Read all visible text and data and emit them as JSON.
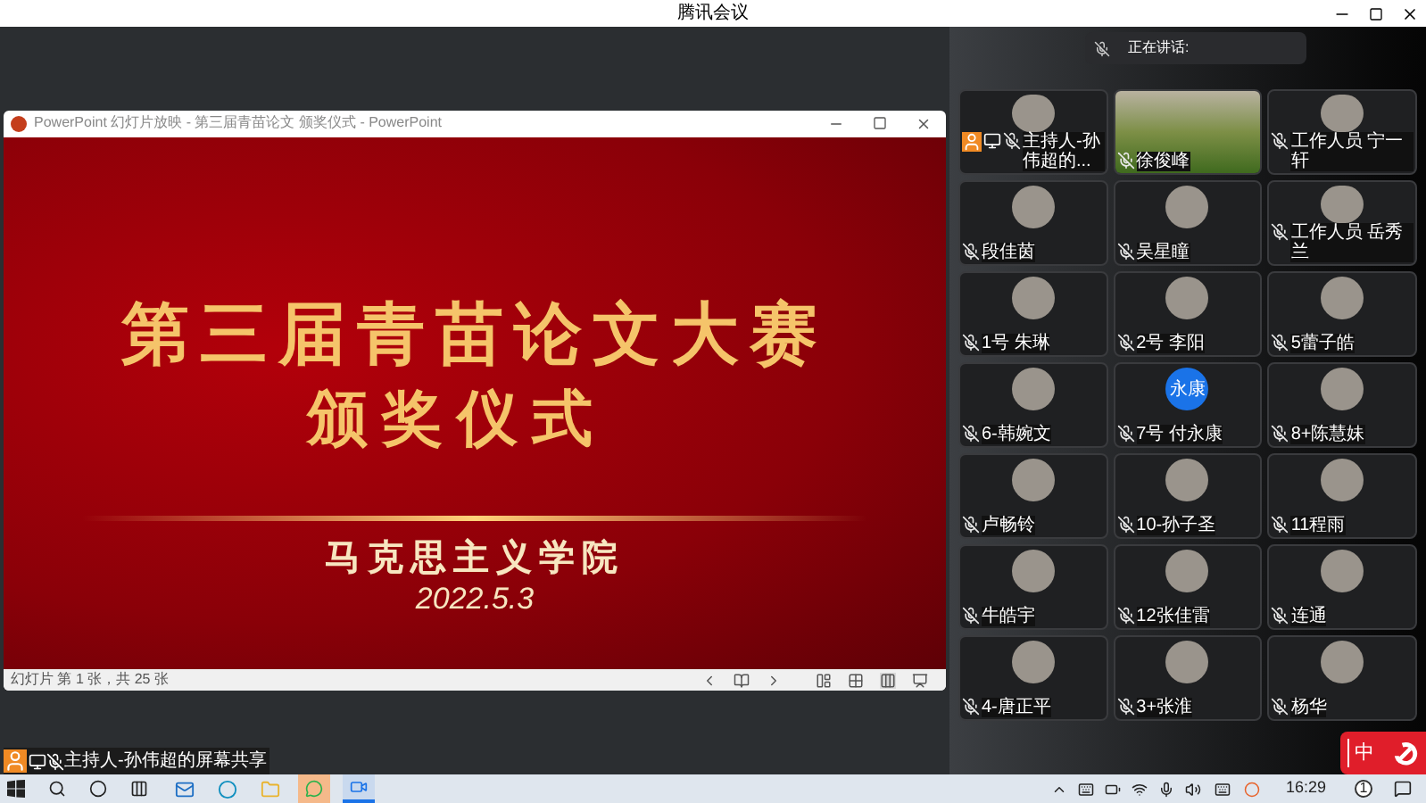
{
  "window": {
    "title": "腾讯会议"
  },
  "speaking": {
    "label": "正在讲话:"
  },
  "ppt": {
    "title": "PowerPoint 幻灯片放映  -  第三届青苗论文 颁奖仪式 - PowerPoint",
    "slide": {
      "heading": "第三届青苗论文大赛",
      "subheading": "颁奖仪式",
      "school": "马克思主义学院",
      "date": "2022.5.3"
    },
    "status": "幻灯片 第 1 张，共 25 张"
  },
  "participants": [
    {
      "name": "主持人-孙伟超的...",
      "kind": "photo",
      "host": true
    },
    {
      "name": "徐俊峰",
      "kind": "video",
      "host": false
    },
    {
      "name": "工作人员 宁一轩",
      "kind": "photo",
      "host": false
    },
    {
      "name": "段佳茵",
      "kind": "photo",
      "host": false
    },
    {
      "name": "吴星瞳",
      "kind": "photo",
      "host": false
    },
    {
      "name": "工作人员 岳秀兰",
      "kind": "photo",
      "host": false
    },
    {
      "name": "1号 朱琳",
      "kind": "photo",
      "host": false
    },
    {
      "name": "2号 李阳",
      "kind": "photo",
      "host": false
    },
    {
      "name": "5蕾子皓",
      "kind": "photo",
      "host": false
    },
    {
      "name": "6-韩婉文",
      "kind": "photo",
      "host": false
    },
    {
      "name": "7号 付永康",
      "kind": "text",
      "avatar_text": "永康",
      "host": false
    },
    {
      "name": "8+陈慧妹",
      "kind": "photo",
      "host": false
    },
    {
      "name": "卢畅铃",
      "kind": "photo",
      "host": false
    },
    {
      "name": "10-孙子圣",
      "kind": "photo",
      "host": false
    },
    {
      "name": "11程雨",
      "kind": "photo",
      "host": false
    },
    {
      "name": "牛皓宇",
      "kind": "photo",
      "host": false
    },
    {
      "name": "12张佳雷",
      "kind": "photo",
      "host": false
    },
    {
      "name": "连通",
      "kind": "photo",
      "host": false
    },
    {
      "name": "4-唐正平",
      "kind": "photo",
      "host": false
    },
    {
      "name": "3+张淮",
      "kind": "photo",
      "host": false
    },
    {
      "name": "杨华",
      "kind": "photo",
      "host": false
    }
  ],
  "share_label": "主持人-孙伟超的屏幕共享",
  "floating_badge": "中",
  "taskbar": {
    "time": "16:29",
    "notification_count": "1"
  }
}
